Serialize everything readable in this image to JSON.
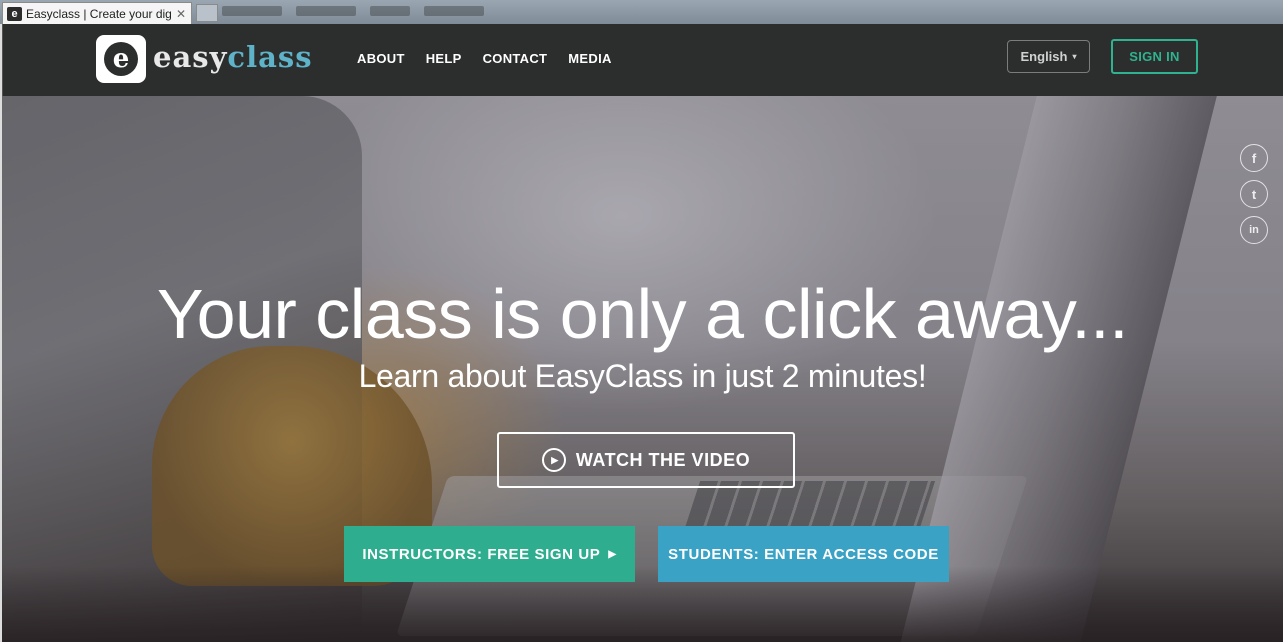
{
  "browser": {
    "tab_title": "Easyclass | Create your digit...",
    "tab_favicon": "e",
    "tab_close": "✕"
  },
  "header": {
    "logo_letter": "e",
    "logo_easy": "easy",
    "logo_class": "class",
    "nav": [
      "ABOUT",
      "HELP",
      "CONTACT",
      "MEDIA"
    ],
    "language": "English",
    "language_caret": "▾",
    "signin_label": "SIGN IN"
  },
  "social": {
    "facebook": "f",
    "twitter": "t",
    "linkedin": "in"
  },
  "hero": {
    "headline": "Your class is only a click away...",
    "subhead": "Learn about EasyClass in just 2 minutes!",
    "watch_label": "WATCH THE VIDEO",
    "play_glyph": "▶",
    "instructors_label": "INSTRUCTORS: FREE SIGN UP",
    "instructors_arrow": "▶",
    "students_label": "STUDENTS: ENTER ACCESS CODE"
  },
  "colors": {
    "header_bg": "#2c2e2d",
    "accent_green": "#2eae8f",
    "accent_blue": "#3aa2c4",
    "logo_class": "#5fb3c9"
  }
}
